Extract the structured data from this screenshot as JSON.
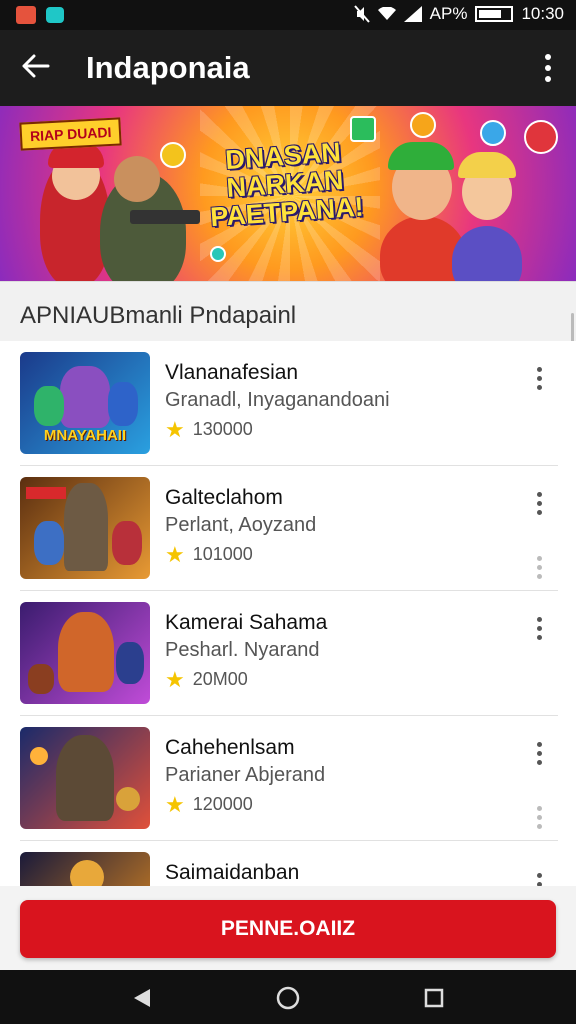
{
  "status_bar": {
    "network_text": "AP%",
    "time": "10:30",
    "icons": [
      "notification-app-icon",
      "notification-app-icon",
      "mute-icon",
      "wifi-icon",
      "signal-icon",
      "battery-icon"
    ]
  },
  "app_bar": {
    "title": "Indaponaia",
    "back_icon": "arrow-left-icon",
    "menu_icon": "more-vert-icon"
  },
  "banner": {
    "badge": "RIAP DUADI",
    "headline_lines": [
      "DNASAN",
      "NARKAN",
      "PAETPANA!"
    ],
    "colors": [
      "#ffd23a",
      "#ff9a1f",
      "#e8367f",
      "#8b2bbd"
    ]
  },
  "section": {
    "title": "APNIAUBmanli  Pndapainl"
  },
  "items": [
    {
      "title": "Vlananafesian",
      "subtitle": "Granadl, Inyaganandoani",
      "rating": "130000",
      "thumb_caption": "MNAYAHAII",
      "thumb_colors": [
        "#1b3a8a",
        "#2aa0e0"
      ]
    },
    {
      "title": "Galteclahom",
      "subtitle": "Perlant, Aoyzand",
      "rating": "101000",
      "thumb_caption": "",
      "thumb_colors": [
        "#5a2e10",
        "#e89a34"
      ]
    },
    {
      "title": "Kamerai Sahama",
      "subtitle": "Pesharl. Nyarand",
      "rating": "20M00",
      "thumb_caption": "",
      "thumb_colors": [
        "#3a1c6e",
        "#c04cd8"
      ]
    },
    {
      "title": "Cahehenlsam",
      "subtitle": "Parianer Abjerand",
      "rating": "120000",
      "thumb_caption": "",
      "thumb_colors": [
        "#1a2a6a",
        "#e0503a"
      ]
    },
    {
      "title": "Saimaidanban",
      "subtitle": "",
      "rating": "",
      "thumb_caption": "",
      "thumb_colors": [
        "#1a1a3a",
        "#e08a20"
      ]
    }
  ],
  "cta": {
    "label": "PENNE.OAIIZ",
    "color": "#d9141e"
  },
  "nav_bar": {
    "buttons": [
      "back-triangle-icon",
      "home-circle-icon",
      "recents-square-icon"
    ]
  }
}
